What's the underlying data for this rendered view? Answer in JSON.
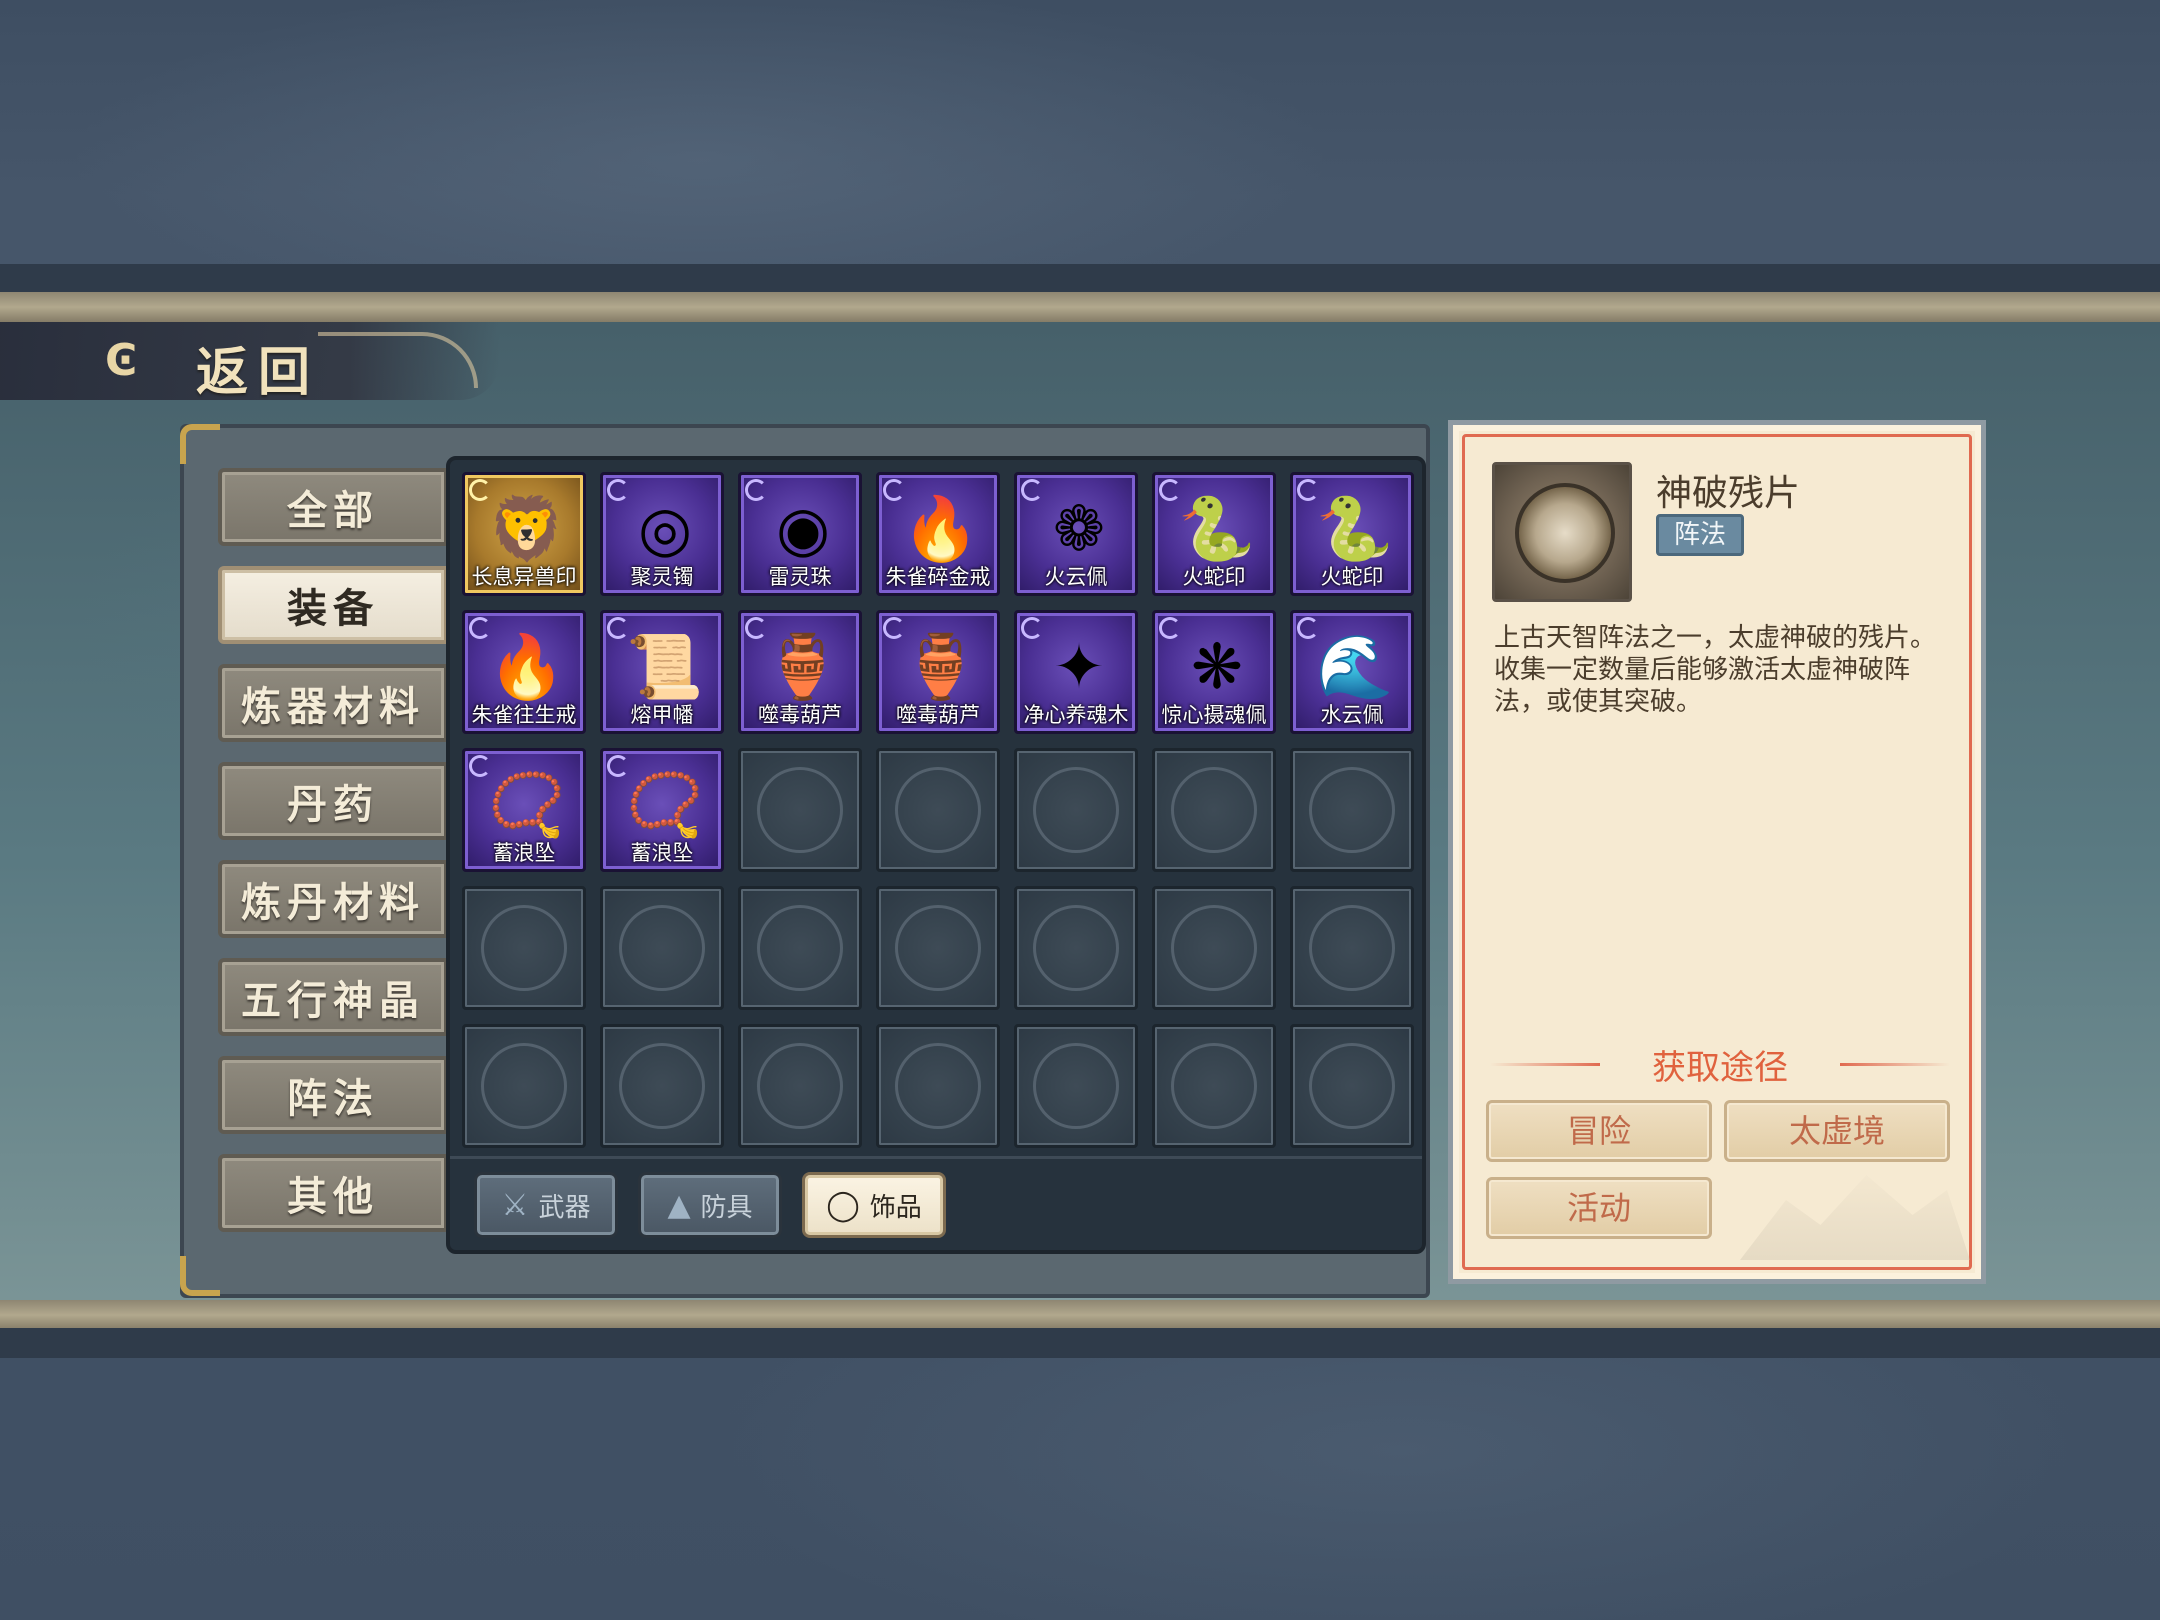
{
  "back": {
    "label": "返回",
    "icon": "back-arrow-icon"
  },
  "categories": [
    {
      "label": "全部",
      "active": false
    },
    {
      "label": "装备",
      "active": true
    },
    {
      "label": "炼器材料",
      "active": false
    },
    {
      "label": "丹药",
      "active": false
    },
    {
      "label": "炼丹材料",
      "active": false
    },
    {
      "label": "五行神晶",
      "active": false
    },
    {
      "label": "阵法",
      "active": false
    },
    {
      "label": "其他",
      "active": false
    }
  ],
  "items": [
    {
      "name": "长息异兽印",
      "rarity": "gold",
      "icon": "beast-seal-icon"
    },
    {
      "name": "聚灵镯",
      "rarity": "purple",
      "icon": "bracelet-icon"
    },
    {
      "name": "雷灵珠",
      "rarity": "purple",
      "icon": "thunder-orb-icon"
    },
    {
      "name": "朱雀碎金戒",
      "rarity": "purple",
      "icon": "phoenix-ring-icon"
    },
    {
      "name": "火云佩",
      "rarity": "purple",
      "icon": "pendant-icon"
    },
    {
      "name": "火蛇印",
      "rarity": "purple",
      "icon": "snake-seal-icon"
    },
    {
      "name": "火蛇印",
      "rarity": "purple",
      "icon": "snake-seal-icon"
    },
    {
      "name": "朱雀往生戒",
      "rarity": "purple",
      "icon": "phoenix-ring-icon"
    },
    {
      "name": "熔甲幡",
      "rarity": "purple",
      "icon": "banner-icon"
    },
    {
      "name": "噬毒葫芦",
      "rarity": "purple",
      "icon": "gourd-icon"
    },
    {
      "name": "噬毒葫芦",
      "rarity": "purple",
      "icon": "gourd-icon"
    },
    {
      "name": "净心养魂木",
      "rarity": "purple",
      "icon": "wood-charm-icon"
    },
    {
      "name": "惊心摄魂佩",
      "rarity": "purple",
      "icon": "jade-pendant-icon"
    },
    {
      "name": "水云佩",
      "rarity": "purple",
      "icon": "water-pendant-icon"
    },
    {
      "name": "蓄浪坠",
      "rarity": "purple",
      "icon": "necklace-icon"
    },
    {
      "name": "蓄浪坠",
      "rarity": "purple",
      "icon": "necklace-icon"
    }
  ],
  "subtabs": [
    {
      "label": "武器",
      "icon": "sword-icon",
      "active": false
    },
    {
      "label": "防具",
      "icon": "armor-icon",
      "active": false
    },
    {
      "label": "饰品",
      "icon": "ring-icon",
      "active": true
    }
  ],
  "detail": {
    "title": "神破残片",
    "type": "阵法",
    "icon": "fragment-icon",
    "description": "上古天智阵法之一，太虚神破的残片。收集一定数量后能够激活太虚神破阵法，或使其突破。",
    "source_title": "获取途径",
    "sources": [
      "冒险",
      "太虚境",
      "活动"
    ]
  },
  "colors": {
    "rarity_purple": "#4a2f93",
    "rarity_gold": "#a87a2c",
    "accent_red": "#e0623e"
  }
}
